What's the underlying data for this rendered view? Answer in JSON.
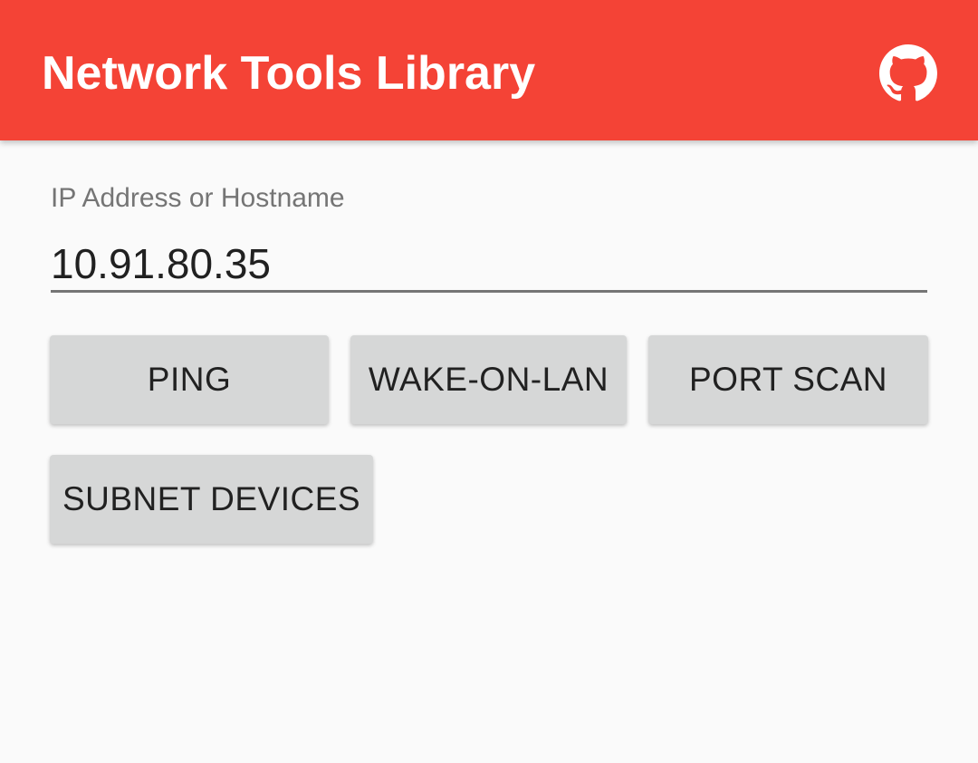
{
  "app_bar": {
    "title": "Network Tools Library",
    "color": "#f44336",
    "action_icon": "github-icon"
  },
  "form": {
    "ip_label": "IP Address or Hostname",
    "ip_value": "10.91.80.35"
  },
  "buttons": {
    "ping": "PING",
    "wake_on_lan": "WAKE-ON-LAN",
    "port_scan": "PORT SCAN",
    "subnet_devices": "SUBNET DEVICES"
  }
}
